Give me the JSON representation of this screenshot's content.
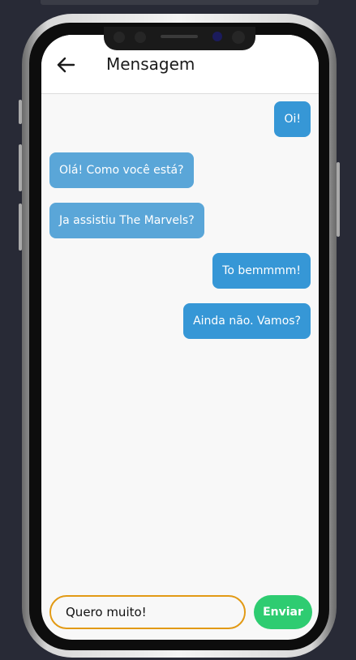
{
  "header": {
    "title": "Mensagem",
    "back_icon": "arrow-left-icon"
  },
  "messages": [
    {
      "text": "Oi!",
      "side": "sent"
    },
    {
      "text": "Olá! Como você está?",
      "side": "received"
    },
    {
      "text": "Ja assistiu The Marvels?",
      "side": "received"
    },
    {
      "text": "To bemmmm!",
      "side": "sent"
    },
    {
      "text": "Ainda não. Vamos?",
      "side": "sent"
    }
  ],
  "composer": {
    "input_value": "Quero muito!",
    "send_label": "Enviar"
  },
  "colors": {
    "sent_bubble": "#3697d6",
    "received_bubble": "#5aa6d8",
    "send_button": "#2ecc71",
    "input_border": "#e29a15"
  }
}
